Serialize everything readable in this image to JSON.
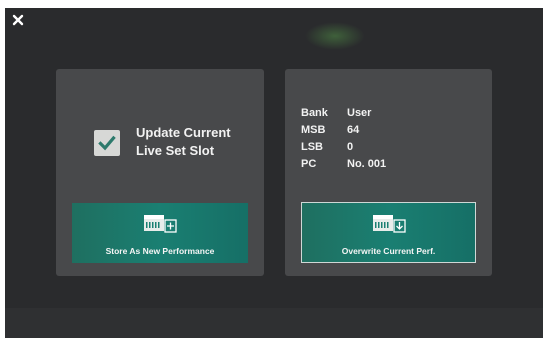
{
  "close_button": {
    "icon": "close-icon"
  },
  "left_panel": {
    "checkbox": {
      "checked": true,
      "label_line1": "Update Current",
      "label_line2": "Live Set Slot"
    },
    "store_button": {
      "label": "Store As New Performance",
      "icon": "keyboard-add-icon"
    }
  },
  "right_panel": {
    "info": [
      {
        "key": "Bank",
        "value": "User"
      },
      {
        "key": "MSB",
        "value": "64"
      },
      {
        "key": "LSB",
        "value": "0"
      },
      {
        "key": "PC",
        "value": "No. 001"
      }
    ],
    "overwrite_button": {
      "label": "Overwrite Current Perf.",
      "icon": "keyboard-download-icon"
    }
  },
  "colors": {
    "accent_teal": "#1a7f72",
    "panel": "#48494b",
    "background": "#2a2b2d",
    "check": "#2d7a6c"
  }
}
